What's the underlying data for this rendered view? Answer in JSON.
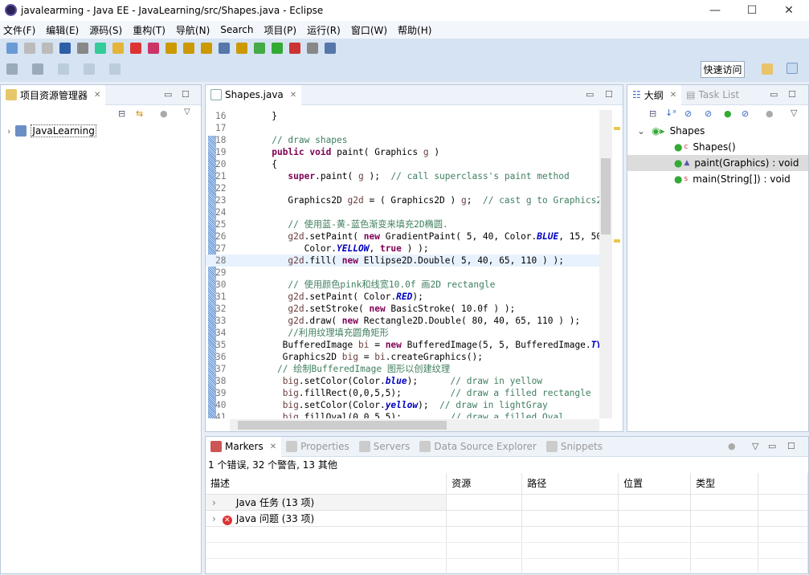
{
  "window": {
    "title": "javalearming - Java EE - JavaLearning/src/Shapes.java - Eclipse",
    "minimize": "—",
    "maximize": "☐",
    "close": "✕"
  },
  "menu": [
    "文件(F)",
    "编辑(E)",
    "源码(S)",
    "重构(T)",
    "导航(N)",
    "Search",
    "项目(P)",
    "运行(R)",
    "窗口(W)",
    "帮助(H)"
  ],
  "toolbar": {
    "quick_access": "快速访问"
  },
  "explorer": {
    "tab": "项目资源管理器",
    "items": [
      {
        "label": "JavaLearning"
      }
    ]
  },
  "editor": {
    "tab": "Shapes.java",
    "lines": [
      {
        "n": "16",
        "t": [
          [
            "",
            "   }"
          ]
        ]
      },
      {
        "n": "17",
        "t": []
      },
      {
        "n": "18",
        "t": [
          [
            "",
            "   "
          ],
          [
            "cm",
            "// draw shapes"
          ]
        ]
      },
      {
        "n": "19",
        "t": [
          [
            "",
            "   "
          ],
          [
            "kw",
            "public"
          ],
          [
            "",
            " "
          ],
          [
            "kw",
            "void"
          ],
          [
            "",
            " paint( Graphics "
          ],
          [
            "vr",
            "g"
          ],
          [
            "",
            " )"
          ]
        ]
      },
      {
        "n": "20",
        "t": [
          [
            "",
            "   {"
          ]
        ]
      },
      {
        "n": "21",
        "t": [
          [
            "",
            "      "
          ],
          [
            "kw",
            "super"
          ],
          [
            "",
            ".paint( "
          ],
          [
            "vr",
            "g"
          ],
          [
            "",
            " );  "
          ],
          [
            "cm",
            "// call superclass's paint method"
          ]
        ]
      },
      {
        "n": "22",
        "t": []
      },
      {
        "n": "23",
        "t": [
          [
            "",
            "      Graphics2D "
          ],
          [
            "vr",
            "g2d"
          ],
          [
            "",
            " = ( Graphics2D ) "
          ],
          [
            "vr",
            "g"
          ],
          [
            "",
            ";  "
          ],
          [
            "cm",
            "// cast g to Graphics2"
          ]
        ]
      },
      {
        "n": "24",
        "t": []
      },
      {
        "n": "25",
        "t": [
          [
            "",
            "      "
          ],
          [
            "cm",
            "// 使用蓝-黄-蓝色渐变来填充2D椭圆."
          ]
        ]
      },
      {
        "n": "26",
        "t": [
          [
            "",
            "      "
          ],
          [
            "vr",
            "g2d"
          ],
          [
            "",
            ".setPaint( "
          ],
          [
            "kw",
            "new"
          ],
          [
            "",
            " GradientPaint( 5, 40, Color."
          ],
          [
            "st",
            "BLUE"
          ],
          [
            "",
            ", 15, 50"
          ]
        ]
      },
      {
        "n": "27",
        "t": [
          [
            "",
            "         Color."
          ],
          [
            "st",
            "YELLOW"
          ],
          [
            "",
            ", "
          ],
          [
            "kw",
            "true"
          ],
          [
            "",
            " ) );"
          ]
        ]
      },
      {
        "n": "28",
        "t": [
          [
            "",
            "      "
          ],
          [
            "vr",
            "g2d"
          ],
          [
            "",
            ".fill( "
          ],
          [
            "kw",
            "new"
          ],
          [
            "",
            " Ellipse2D.Double( 5, 40, 65, 110 ) );"
          ]
        ],
        "current": true
      },
      {
        "n": "29",
        "t": []
      },
      {
        "n": "30",
        "t": [
          [
            "",
            "      "
          ],
          [
            "cm",
            "// 使用颜色pink和线宽10.0f 画2D rectangle"
          ]
        ]
      },
      {
        "n": "31",
        "t": [
          [
            "",
            "      "
          ],
          [
            "vr",
            "g2d"
          ],
          [
            "",
            ".setPaint( Color."
          ],
          [
            "st",
            "RED"
          ],
          [
            "",
            ");"
          ]
        ]
      },
      {
        "n": "32",
        "t": [
          [
            "",
            "      "
          ],
          [
            "vr",
            "g2d"
          ],
          [
            "",
            ".setStroke( "
          ],
          [
            "kw",
            "new"
          ],
          [
            "",
            " BasicStroke( 10.0f ) );"
          ]
        ]
      },
      {
        "n": "33",
        "t": [
          [
            "",
            "      "
          ],
          [
            "vr",
            "g2d"
          ],
          [
            "",
            ".draw( "
          ],
          [
            "kw",
            "new"
          ],
          [
            "",
            " Rectangle2D.Double( 80, 40, 65, 110 ) );"
          ]
        ]
      },
      {
        "n": "34",
        "t": [
          [
            "",
            "      "
          ],
          [
            "cm",
            "//利用纹理填充圆角矩形"
          ]
        ]
      },
      {
        "n": "35",
        "t": [
          [
            "",
            "     BufferedImage "
          ],
          [
            "vr",
            "bi"
          ],
          [
            "",
            " = "
          ],
          [
            "kw",
            "new"
          ],
          [
            "",
            " BufferedImage(5, 5, BufferedImage."
          ],
          [
            "st",
            "TY"
          ]
        ]
      },
      {
        "n": "36",
        "t": [
          [
            "",
            "     Graphics2D "
          ],
          [
            "vr",
            "big"
          ],
          [
            "",
            " = "
          ],
          [
            "vr",
            "bi"
          ],
          [
            "",
            ".createGraphics();"
          ]
        ]
      },
      {
        "n": "37",
        "t": [
          [
            "",
            "    "
          ],
          [
            "cm",
            "// 绘制BufferedImage 图形以创建纹理"
          ]
        ]
      },
      {
        "n": "38",
        "t": [
          [
            "",
            "     "
          ],
          [
            "vr",
            "big"
          ],
          [
            "",
            ".setColor(Color."
          ],
          [
            "st",
            "blue"
          ],
          [
            "",
            ");      "
          ],
          [
            "cm",
            "// draw in yellow"
          ]
        ]
      },
      {
        "n": "39",
        "t": [
          [
            "",
            "     "
          ],
          [
            "vr",
            "big"
          ],
          [
            "",
            ".fillRect(0,0,5,5);         "
          ],
          [
            "cm",
            "// draw a filled rectangle"
          ]
        ]
      },
      {
        "n": "40",
        "t": [
          [
            "",
            "     "
          ],
          [
            "vr",
            "big"
          ],
          [
            "",
            ".setColor(Color."
          ],
          [
            "st",
            "yellow"
          ],
          [
            "",
            ");  "
          ],
          [
            "cm",
            "// draw in lightGray"
          ]
        ]
      },
      {
        "n": "41",
        "t": [
          [
            "",
            "     "
          ],
          [
            "vr",
            "big"
          ],
          [
            "",
            ".fillOval(0,0,5,5);         "
          ],
          [
            "cm",
            "// draw a filled Oval"
          ]
        ]
      }
    ]
  },
  "outline": {
    "tabs": [
      "大纲",
      "Task List"
    ],
    "root": "Shapes",
    "items": [
      {
        "label": "Shapes()",
        "mark": "c"
      },
      {
        "label": "paint(Graphics) : void",
        "mark": "▲",
        "selected": true
      },
      {
        "label": "main(String[]) : void",
        "mark": "s"
      }
    ]
  },
  "markers": {
    "tabs": [
      "Markers",
      "Properties",
      "Servers",
      "Data Source Explorer",
      "Snippets"
    ],
    "summary": "1 个错误, 32 个警告, 13 其他",
    "columns": [
      "描述",
      "资源",
      "路径",
      "位置",
      "类型"
    ],
    "rows": [
      {
        "label": "Java 任务 (13 项)",
        "icon": "none"
      },
      {
        "label": "Java 问题 (33 项)",
        "icon": "error"
      }
    ]
  }
}
